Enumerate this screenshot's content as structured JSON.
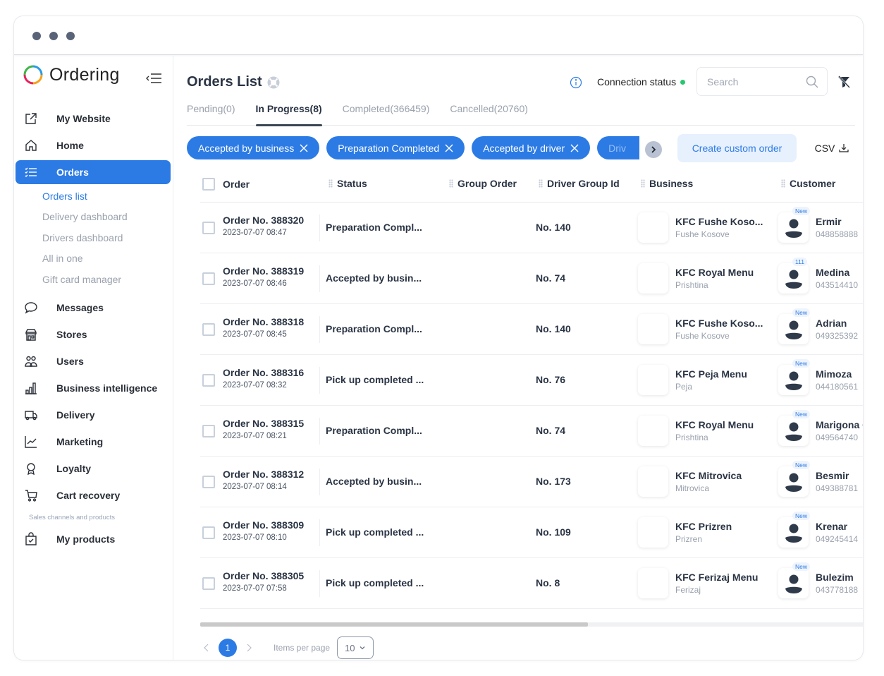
{
  "app": {
    "name": "Ordering"
  },
  "sidebar": {
    "items": [
      {
        "label": "My Website",
        "icon": "external-link-icon"
      },
      {
        "label": "Home",
        "icon": "home-icon"
      },
      {
        "label": "Orders",
        "icon": "list-icon",
        "active": true
      }
    ],
    "orders_sub": [
      {
        "label": "Orders list",
        "active": true
      },
      {
        "label": "Delivery dashboard"
      },
      {
        "label": "Drivers dashboard"
      },
      {
        "label": "All in one"
      },
      {
        "label": "Gift card manager"
      }
    ],
    "items2": [
      {
        "label": "Messages",
        "icon": "chat-icon"
      },
      {
        "label": "Stores",
        "icon": "store-icon"
      },
      {
        "label": "Users",
        "icon": "users-icon"
      },
      {
        "label": "Business intelligence",
        "icon": "bar-chart-icon"
      },
      {
        "label": "Delivery",
        "icon": "truck-icon"
      },
      {
        "label": "Marketing",
        "icon": "line-chart-icon"
      },
      {
        "label": "Loyalty",
        "icon": "award-icon"
      },
      {
        "label": "Cart recovery",
        "icon": "cart-icon"
      }
    ],
    "section_label": "Sales channels and products",
    "items3": [
      {
        "label": "My products",
        "icon": "bag-icon"
      }
    ]
  },
  "header": {
    "title": "Orders List",
    "connection_status": "Connection status",
    "connection_color": "#27c76f",
    "search_placeholder": "Search"
  },
  "tabs": [
    {
      "label": "Pending(0)"
    },
    {
      "label": "In Progress(8)",
      "active": true
    },
    {
      "label": "Completed(366459)"
    },
    {
      "label": "Cancelled(20760)"
    }
  ],
  "chips": [
    {
      "label": "Accepted by business"
    },
    {
      "label": "Preparation Completed"
    },
    {
      "label": "Accepted by driver"
    },
    {
      "label": "Driv"
    }
  ],
  "actions": {
    "create_order": "Create custom order",
    "csv": "CSV"
  },
  "table": {
    "columns": [
      "Order",
      "Status",
      "Group Order",
      "Driver Group Id",
      "Business",
      "Customer"
    ],
    "rows": [
      {
        "order": "Order No. 388320",
        "date": "2023-07-07 08:47",
        "status": "Preparation Compl...",
        "driver_group": "No. 140",
        "business": "KFC Fushe Koso...",
        "city": "Fushe Kosove",
        "badge": "New",
        "customer": "Ermir",
        "phone": "048858888"
      },
      {
        "order": "Order No. 388319",
        "date": "2023-07-07 08:46",
        "status": "Accepted by busin...",
        "driver_group": "No. 74",
        "business": "KFC Royal Menu",
        "city": "Prishtina",
        "badge": "111",
        "customer": "Medina",
        "phone": "043514410"
      },
      {
        "order": "Order No. 388318",
        "date": "2023-07-07 08:45",
        "status": "Preparation Compl...",
        "driver_group": "No. 140",
        "business": "KFC Fushe Koso...",
        "city": "Fushe Kosove",
        "badge": "New",
        "customer": "Adrian",
        "phone": "049325392"
      },
      {
        "order": "Order No. 388316",
        "date": "2023-07-07 08:32",
        "status": "Pick up completed ...",
        "driver_group": "No. 76",
        "business": "KFC Peja Menu",
        "city": "Peja",
        "badge": "New",
        "customer": "Mimoza",
        "phone": "044180561"
      },
      {
        "order": "Order No. 388315",
        "date": "2023-07-07 08:21",
        "status": "Preparation Compl...",
        "driver_group": "No. 74",
        "business": "KFC Royal Menu",
        "city": "Prishtina",
        "badge": "New",
        "customer": "Marigona C",
        "phone": "049564740"
      },
      {
        "order": "Order No. 388312",
        "date": "2023-07-07 08:14",
        "status": "Accepted by busin...",
        "driver_group": "No. 173",
        "business": "KFC Mitrovica",
        "city": "Mitrovica",
        "badge": "New",
        "customer": "Besmir",
        "phone": "049388781"
      },
      {
        "order": "Order No. 388309",
        "date": "2023-07-07 08:10",
        "status": "Pick up completed ...",
        "driver_group": "No. 109",
        "business": "KFC Prizren",
        "city": "Prizren",
        "badge": "New",
        "customer": "Krenar",
        "phone": "049245414"
      },
      {
        "order": "Order No. 388305",
        "date": "2023-07-07 07:58",
        "status": "Pick up completed ...",
        "driver_group": "No. 8",
        "business": "KFC Ferizaj Menu",
        "city": "Ferizaj",
        "badge": "New",
        "customer": "Bulezim",
        "phone": "043778188"
      }
    ]
  },
  "pagination": {
    "current_page": "1",
    "items_per_page_label": "Items per page",
    "items_per_page": "10"
  },
  "colors": {
    "accent": "#2c7be5",
    "chip_bg": "#2c7be5",
    "create_bg": "#e7f0fd"
  }
}
